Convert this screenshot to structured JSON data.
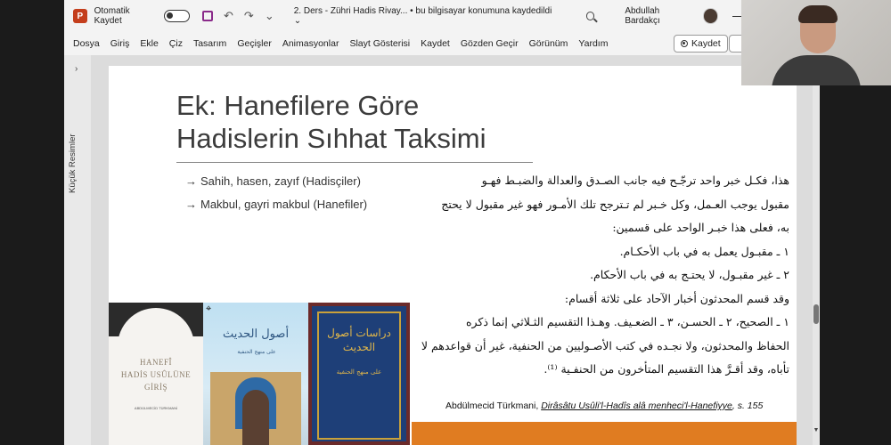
{
  "titlebar": {
    "app_logo": "P",
    "autosave_label": "Otomatik Kaydet",
    "document_title": "2. Ders - Zühri Hadis Rivay... • bu bilgisayar konumuna kaydedildi ⌄",
    "user_name": "Abdullah Bardakçı",
    "undo_icon": "↶",
    "redo_icon": "↷",
    "more_icon": "⌄"
  },
  "ribbon": {
    "tabs": [
      "Dosya",
      "Giriş",
      "Ekle",
      "Çiz",
      "Tasarım",
      "Geçişler",
      "Animasyonlar",
      "Slayt Gösterisi",
      "Kaydet",
      "Gözden Geçir",
      "Görünüm",
      "Yardım"
    ],
    "record_button": "Kaydet"
  },
  "left_panel": {
    "label": "Küçük Resimler",
    "chevron": "›"
  },
  "slide": {
    "title_line1": "Ek: Hanefilere Göre",
    "title_line2": "Hadislerin Sıhhat Taksimi",
    "bullets": [
      "Sahih, hasen, zayıf (Hadisçiler)",
      "Makbul, gayri makbul (Hanefiler)"
    ],
    "bullet_arrow": "→",
    "arabic_lines": [
      "هذا، فكـل خبر واحد ترجّـح فيه جانب الصـدق والعدالة والضبـط فهـو",
      "مقبول يوجب العـمل، وكل خـبر لم تـترجح تلك الأمـور فهو غير مقبول لا يحتج",
      "به، فعلى هذا خبـر الواحد على قسمين:",
      "١ ـ مقبـول يعمل به في باب الأحكـام.",
      "٢ ـ غير مقبـول، لا يحتـج به في باب الأحكام.",
      "وقد قسم المحدثون أخبار الآحاد على ثلاثة أقسام:",
      "١ ـ الصحيح، ٢ ـ الحسـن، ٣ ـ الضعـيف. وهـذا التقسيم الثـلاثي إنما ذكره",
      "الحفاظ والمحدثون، ولا نجـده في كتب الأصـوليين من الحنفية، غير أن قواعدهم لا",
      "تأباه، وقد أقـرَّ هذا التقسيم المتأخرون من الحنفـية ⁽¹⁾."
    ],
    "citation": {
      "author": "Abdülmecid Türkmani, ",
      "work": "Dirâsâtu Usûli'l-Hadîs alâ menheci'l-Hanefiyye",
      "page": ", s. 155"
    },
    "books": [
      {
        "title_lines": [
          "HANEFÎ",
          "HADİS USÛLÜNE",
          "GİRİŞ"
        ],
        "author": "ABDÜLMECİD TÜRKMANİ"
      },
      {
        "title": "أصول الحديث",
        "subtitle": "على منهج الحنفية"
      },
      {
        "title": "دراسات أصول الحديث",
        "subtitle": "على منهج الحنفية"
      }
    ]
  },
  "scrollbar": {
    "down_arrow": "▼"
  },
  "cursor": "⌖"
}
